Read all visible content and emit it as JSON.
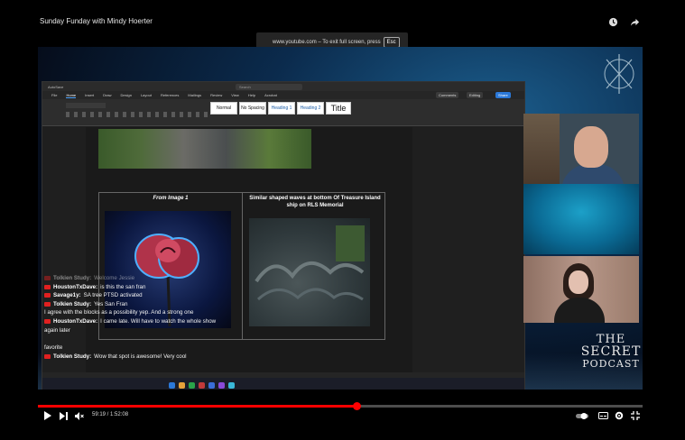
{
  "page": {
    "title": "Sunday Funday with Mindy Hoerter",
    "fullscreen_toast": {
      "message": "www.youtube.com – To exit full screen, press",
      "key": "Esc"
    }
  },
  "word": {
    "tabs": [
      "File",
      "Home",
      "Insert",
      "Draw",
      "Design",
      "Layout",
      "References",
      "Mailings",
      "Review",
      "View",
      "Help",
      "Acrobat"
    ],
    "active_tab": "Home",
    "search_placeholder": "Search",
    "comments_label": "Comments",
    "editing_label": "Editing",
    "share_label": "Share",
    "styles": [
      "Normal",
      "No Spacing",
      "Heading 1",
      "Heading 2",
      "Title"
    ],
    "col1_heading": "From Image 1",
    "col2_heading": "Similar shaped waves at bottom Of Treasure Island ship on RLS Memorial"
  },
  "chat": [
    {
      "name": "Tolkien Study:",
      "message": "Welcome Jessie",
      "faded": true
    },
    {
      "name": "HoustonTxDave:",
      "message": "is this the san fran",
      "faded": false
    },
    {
      "name": "Savage1y:",
      "message": "SA tree PTSD activated",
      "faded": false
    },
    {
      "name": "Tolkien Study:",
      "message": "Yes San Fran",
      "faded": false
    },
    {
      "name": "",
      "message": "I agree with the blocks as a possibility yep. And a strong one",
      "faded": false
    },
    {
      "name": "HoustonTxDave:",
      "message": "I came late. Will have to watch the whole show",
      "faded": false
    },
    {
      "name": "",
      "message": "again later",
      "faded": false
    },
    {
      "name": "",
      "message": "favorite",
      "faded": false
    },
    {
      "name": "Tolkien Study:",
      "message": "Wow that spot is awesome! Very cool",
      "faded": false
    }
  ],
  "podcast_logo": {
    "line1": "THE",
    "line2": "SECRET",
    "line3": "PODCAST"
  },
  "player": {
    "current_time": "59:19",
    "duration": "1:52:08",
    "time_display": "59:19 / 1:52:08",
    "progress": 0.527
  },
  "colors": {
    "progress": "#ff0000",
    "yt_badge": "#e02020",
    "accent": "#4aa3ff"
  },
  "icons": {
    "top": [
      "clock-icon",
      "share-icon"
    ],
    "controls_left": [
      "play-icon",
      "next-icon",
      "mute-icon"
    ],
    "controls_right": [
      "autoplay-toggle-icon",
      "captions-icon",
      "settings-icon",
      "fullscreen-exit-icon"
    ]
  }
}
